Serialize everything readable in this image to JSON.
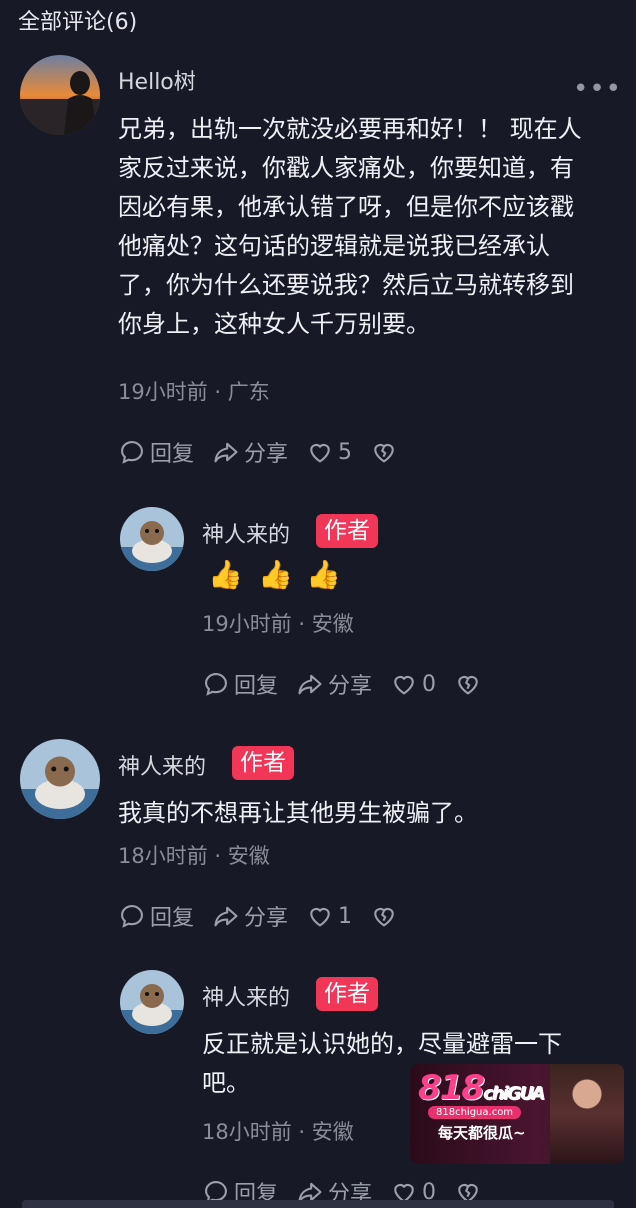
{
  "header": {
    "title": "全部评论(6)"
  },
  "comments": [
    {
      "user": "Hello树",
      "text_lines": [
        "兄弟，出轨一次就没必要再和好！！ 现在人",
        "家反过来说，你戳人家痛处，你要知道，有",
        "因必有果，他承认错了呀，但是你不应该戳",
        "他痛处？这句话的逻辑就是说我已经承认",
        "了，你为什么还要说我？然后立马就转移到",
        "你身上，这种女人千万别要。"
      ],
      "meta": "19小时前 · 广东",
      "reply_label": "回复",
      "share_label": "分享",
      "likes": "5",
      "more": "•••"
    },
    {
      "user": "神人来的",
      "badge": "作者",
      "emojis": [
        "👍",
        "👍",
        "👍"
      ],
      "meta": "19小时前 · 安徽",
      "reply_label": "回复",
      "share_label": "分享",
      "likes": "0"
    },
    {
      "user": "神人来的",
      "badge": "作者",
      "text": "我真的不想再让其他男生被骗了。",
      "meta": "18小时前 · 安徽",
      "reply_label": "回复",
      "share_label": "分享",
      "likes": "1"
    },
    {
      "user": "神人来的",
      "badge": "作者",
      "text_lines": [
        "反正就是认识她的，尽量避雷一下",
        "吧。"
      ],
      "meta": "18小时前 · 安徽",
      "reply_label": "回复",
      "share_label": "分享",
      "likes": "0"
    }
  ],
  "ad": {
    "logo_num": "818",
    "logo_text": "chiGUA",
    "url": "818chigua.com",
    "slogan": "每天都很瓜~"
  },
  "colors": {
    "background": "#171a26",
    "badge": "#f23658",
    "meta": "#8a8d98"
  }
}
